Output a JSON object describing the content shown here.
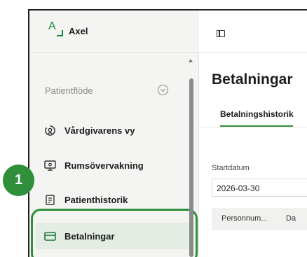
{
  "app": {
    "name": "Axel",
    "logo_letter": "A"
  },
  "sidebar": {
    "section_title": "Patientflöde",
    "items": [
      {
        "label": "Vårdgivarens vy",
        "icon": "vardgivare-icon"
      },
      {
        "label": "Rumsövervakning",
        "icon": "monitor-icon"
      },
      {
        "label": "Patienthistorik",
        "icon": "history-icon"
      },
      {
        "label": "Betalningar",
        "icon": "payment-card-icon",
        "selected": true
      }
    ]
  },
  "annotation": {
    "step": "1",
    "color": "#2f8f3a"
  },
  "main": {
    "title": "Betalningar",
    "tabs": [
      {
        "label": "Betalningshistorik",
        "active": true
      }
    ],
    "start_date": {
      "label": "Startdatum",
      "value": "2026-03-30"
    },
    "table": {
      "columns": [
        "Personnum...",
        "Da"
      ]
    }
  },
  "colors": {
    "accent": "#2f8f3a",
    "sidebar_bg": "#f4f4f2",
    "selected_bg": "#e3ede3"
  }
}
